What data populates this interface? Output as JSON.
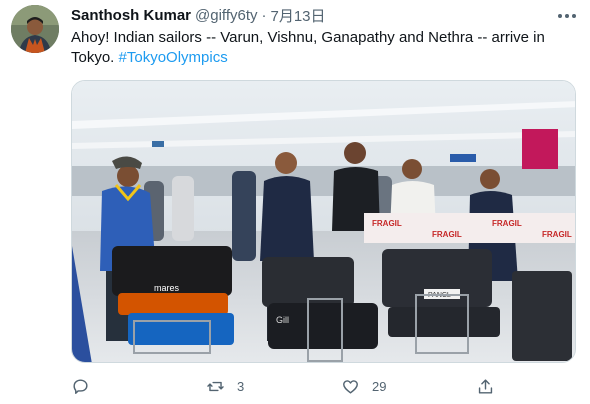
{
  "tweet": {
    "author_name": "Santhosh Kumar",
    "author_handle": "@giffy6ty",
    "separator": "·",
    "date": "7月13日",
    "text_line": "Ahoy! Indian sailors -- Varun, Vishnu, Ganapathy and Nethra -- arrive in Tokyo.",
    "hashtag": "#TokyoOlympics",
    "photo_labels": {
      "fragile": "FRAGIL",
      "bag_brand": "Gill",
      "bag_brand_2": "mares",
      "tag": "PANCL"
    }
  },
  "actions": {
    "reply_icon": "reply-icon",
    "retweet_icon": "retweet-icon",
    "retweet_count": "3",
    "like_icon": "heart-icon",
    "like_count": "29",
    "share_icon": "share-icon"
  },
  "colors": {
    "accent": "#1d9bf0",
    "secondary_text": "#536471",
    "primary_text": "#0f1419"
  }
}
